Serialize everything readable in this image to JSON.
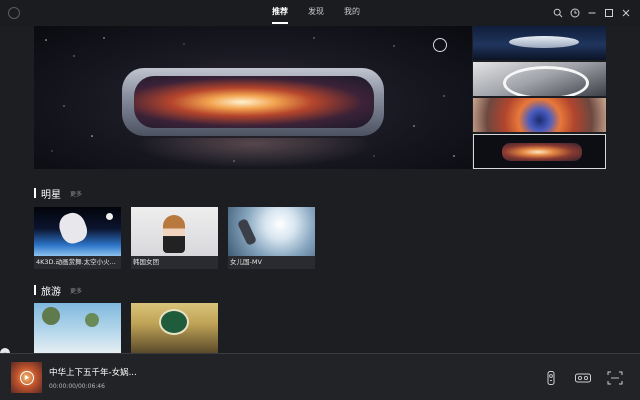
{
  "nav": {
    "tabs": [
      {
        "label": "推荐",
        "active": true
      },
      {
        "label": "发现",
        "active": false
      },
      {
        "label": "我的",
        "active": false
      }
    ]
  },
  "window_controls": [
    "search-icon",
    "clock-icon",
    "minimize-icon",
    "maximize-icon",
    "close-icon"
  ],
  "sections": [
    {
      "title": "明星",
      "more_label": "更多",
      "items": [
        {
          "caption": "4K3D.动画赏舞.太空小火..."
        },
        {
          "caption": "韩国女团"
        },
        {
          "caption": "女儿国-MV"
        }
      ]
    },
    {
      "title": "旅游",
      "more_label": "更多",
      "items": [
        {
          "caption": ""
        },
        {
          "caption": ""
        }
      ]
    }
  ],
  "player": {
    "title": "中华上下五千年-女娲...",
    "time": "00:00:00/00:06:46"
  },
  "colors": {
    "background": "#1d1e22",
    "titlebar": "#1b1c20",
    "accent": "#ffffff",
    "muted_text": "#8c8d92"
  }
}
